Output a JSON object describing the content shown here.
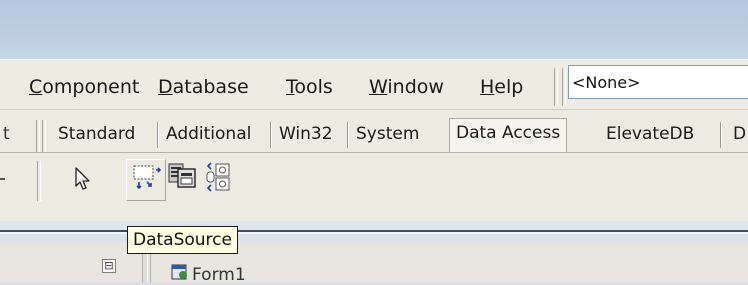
{
  "menu": {
    "items": [
      {
        "mnemonic": "C",
        "rest": "omponent"
      },
      {
        "mnemonic": "D",
        "rest": "atabase"
      },
      {
        "mnemonic": "T",
        "rest": "ools"
      },
      {
        "mnemonic": "W",
        "rest": "indow"
      },
      {
        "mnemonic": "H",
        "rest": "elp"
      }
    ],
    "combo_value": "<None>"
  },
  "palette": {
    "cut_tab": "t",
    "tabs": [
      "Standard",
      "Additional",
      "Win32",
      "System",
      "Data Access",
      "ElevateDB",
      "D"
    ],
    "active_tab": "Data Access",
    "components": [
      {
        "icon": "pointer-arrow-icon"
      },
      {
        "icon": "datasource-icon",
        "pressed": true
      },
      {
        "icon": "clientdataset-icon"
      },
      {
        "icon": "datasetprovider-icon"
      }
    ]
  },
  "tooltip": "DataSource",
  "structure": {
    "node_label": "Form1",
    "expander_glyph": "⊟"
  }
}
